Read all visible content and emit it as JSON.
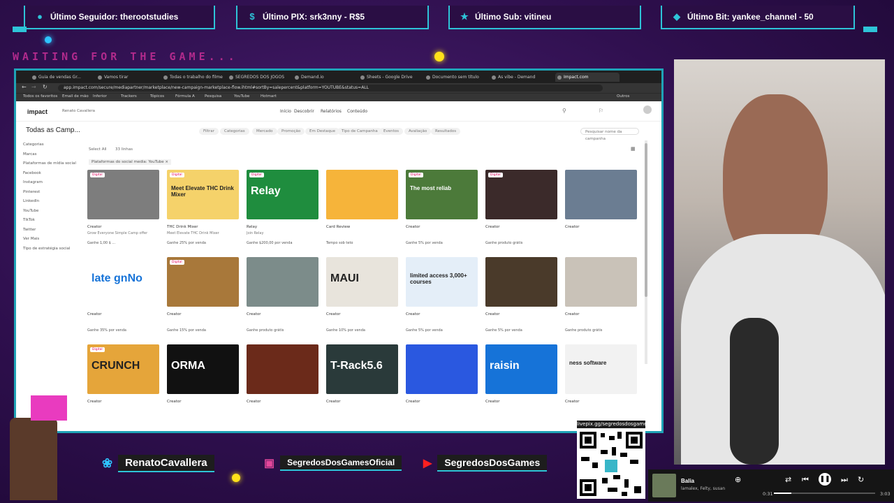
{
  "alerts": {
    "follower": "Último Seguidor: therootstudies",
    "pix": "Último PIX: srk3nny - R$5",
    "sub": "Último Sub: vitineu",
    "bit": "Último Bit: yankee_channel - 50"
  },
  "overlay": {
    "waiting": "WAITING FOR THE GAME..."
  },
  "browser": {
    "tabs": [
      "Guia de vendas Gr...",
      "Vamos tirar",
      "Todas o trabalho do filme",
      "SEGREDOS DOS JOGOS",
      "Demand.io",
      "Sheets - Google Drive",
      "Documento sem título",
      "As vibe - Demand",
      "Impact.com"
    ],
    "url": "app.impact.com/secure/mediapartner/marketplace/new-campaign-marketplace-flow.ihtml#sortBy=salepercent&platform=YOUTUBE&status=ALL",
    "bookmarks": [
      "Todos os favoritos",
      "Email de mão",
      "Inferior",
      "Trackers",
      "Tópicos",
      "Fórmula A",
      "Pesquisa",
      "YouTube",
      "Hotmart",
      "Outros"
    ],
    "app": {
      "logo": "impact",
      "account": "Renato Cavallera",
      "nav": [
        "Início",
        "Descobrir",
        "Relatórios",
        "Conteúdo"
      ],
      "page_title": "Todas as Camp...",
      "filters": [
        "Filtrar",
        "Categorias",
        "Mercado",
        "Promoção",
        "Em Destaque",
        "Tipo de Campanha",
        "Eventos",
        "Avaliação",
        "Resultados"
      ],
      "search_placeholder": "Pesquisar nome da campanha",
      "select_all": "Select All",
      "results": "33 linhas",
      "active_filter": "Plataformas do social media: YouTube ×",
      "sidebar": [
        "Categorias",
        "Marcas",
        "Plataformas de mídia social",
        "Facebook",
        "Instagram",
        "Pinterest",
        "LinkedIn",
        "YouTube",
        "TikTok",
        "Twitter",
        "Ver Mais",
        "Tipo de estratégia social"
      ]
    },
    "cards": [
      {
        "chip": "Digital",
        "brand": "Creator",
        "desc": "Grow Everyone Simple Camp offer",
        "pay": "Ganhe 1,00 $ ...",
        "thumb_text": "",
        "bg": "#7d7d7d"
      },
      {
        "chip": "Digital",
        "brand": "THC Drink Mixer",
        "desc": "Meet Elevate THC Drink Mixer",
        "pay": "Ganhe 25% por venda",
        "thumb_text": "Meet Elevate THC Drink Mixer",
        "bg": "#f5d26a"
      },
      {
        "chip": "Digital",
        "brand": "Relay",
        "desc": "Join Relay",
        "pay": "Ganhe $200,00 por venda",
        "thumb_text": "Relay",
        "bg": "#1f8d3e"
      },
      {
        "chip": "",
        "brand": "Card Review",
        "desc": "",
        "pay": "Tempo sob teto",
        "thumb_text": "",
        "bg": "#f6b43a"
      },
      {
        "chip": "Digital",
        "brand": "Creator",
        "desc": "",
        "pay": "Ganhe 5% por venda",
        "thumb_text": "The most reliab",
        "bg": "#4c7a3a"
      },
      {
        "chip": "Digital",
        "brand": "Creator",
        "desc": "",
        "pay": "Ganhe produto grátis",
        "thumb_text": "",
        "bg": "#3b2a2a"
      },
      {
        "chip": "",
        "brand": "Creator",
        "desc": "",
        "pay": "",
        "thumb_text": "",
        "bg": "#6b7d92"
      },
      {
        "chip": "",
        "brand": "Creator",
        "desc": "",
        "pay": "Ganhe 35% por venda",
        "thumb_text": "late gnNo",
        "bg": "#ffffff"
      },
      {
        "chip": "Digital",
        "brand": "Creator",
        "desc": "",
        "pay": "Ganhe 15% por venda",
        "thumb_text": "",
        "bg": "#a8783a"
      },
      {
        "chip": "",
        "brand": "Creator",
        "desc": "",
        "pay": "Ganhe produto grátis",
        "thumb_text": "",
        "bg": "#7c8c8a"
      },
      {
        "chip": "",
        "brand": "Creator",
        "desc": "",
        "pay": "Ganhe 10% por venda",
        "thumb_text": "MAUI",
        "bg": "#e8e4dc"
      },
      {
        "chip": "",
        "brand": "Creator",
        "desc": "",
        "pay": "Ganhe 5% por venda",
        "thumb_text": "limited access 3,000+ courses",
        "bg": "#e4eef8"
      },
      {
        "chip": "",
        "brand": "Creator",
        "desc": "",
        "pay": "Ganhe 5% por venda",
        "thumb_text": "",
        "bg": "#4a3a2a"
      },
      {
        "chip": "",
        "brand": "Creator",
        "desc": "",
        "pay": "Ganhe produto grátis",
        "thumb_text": "",
        "bg": "#c9c2b8"
      },
      {
        "chip": "Digital",
        "brand": "Creator",
        "desc": "",
        "pay": "",
        "thumb_text": "CRUNCH",
        "bg": "#e5a53a"
      },
      {
        "chip": "",
        "brand": "Creator",
        "desc": "",
        "pay": "",
        "thumb_text": "ORMA",
        "bg": "#111111"
      },
      {
        "chip": "",
        "brand": "Creator",
        "desc": "",
        "pay": "",
        "thumb_text": "",
        "bg": "#6b2a1a"
      },
      {
        "chip": "",
        "brand": "Creator",
        "desc": "",
        "pay": "",
        "thumb_text": "T-Rack5.6",
        "bg": "#2a3a3a"
      },
      {
        "chip": "",
        "brand": "Creator",
        "desc": "",
        "pay": "",
        "thumb_text": "",
        "bg": "#2a58e0"
      },
      {
        "chip": "",
        "brand": "Creator",
        "desc": "",
        "pay": "",
        "thumb_text": "raisin",
        "bg": "#1673d8"
      },
      {
        "chip": "",
        "brand": "Creator",
        "desc": "",
        "pay": "",
        "thumb_text": "ness software",
        "bg": "#f2f2f2"
      }
    ]
  },
  "socials": {
    "twitter": "RenatoCavallera",
    "instagram": "SegredosDosGamesOficial",
    "youtube": "SegredosDosGames"
  },
  "qr_url": "livepix.gg/segredosdosgames",
  "player": {
    "title": "Balia",
    "artists": "lamalex, Felty, susan",
    "elapsed": "0:31",
    "duration": "3:03",
    "progress": 0.17
  },
  "colors": {
    "accent": "#2ec4d8",
    "background": "#2e0f4d",
    "waiting": "#b12a8c"
  }
}
